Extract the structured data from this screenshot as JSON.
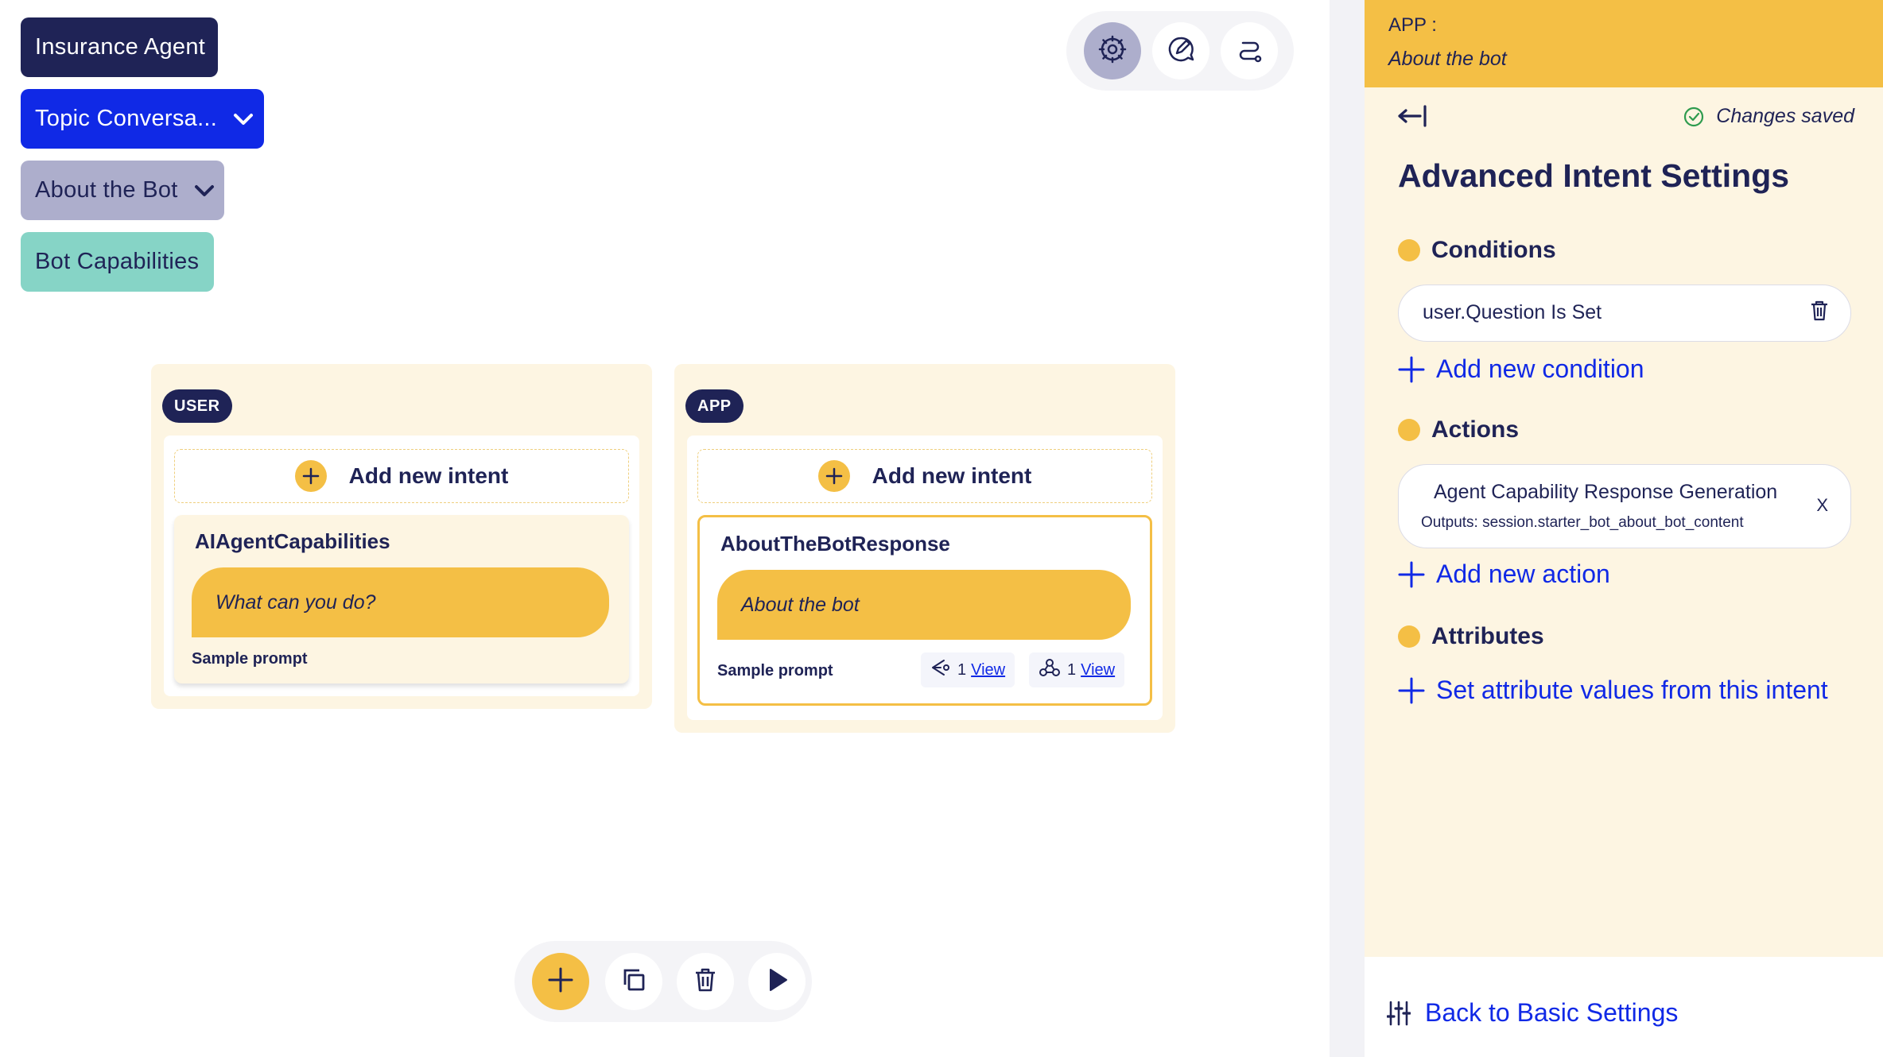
{
  "breadcrumbs": [
    {
      "label": "Insurance Agent"
    },
    {
      "label": "Topic Conversa..."
    },
    {
      "label": "About the Bot"
    },
    {
      "label": "Bot Capabilities"
    }
  ],
  "view_toolbar": {
    "icons": [
      "brain-settings-icon",
      "edit-chat-icon",
      "flow-route-icon"
    ],
    "active_index": 0
  },
  "columns": {
    "user": {
      "badge": "USER",
      "add_intent_label": "Add new intent",
      "intent": {
        "title": "AIAgentCapabilities",
        "prompt": "What can you do?",
        "sample_label": "Sample prompt"
      }
    },
    "app": {
      "badge": "APP",
      "add_intent_label": "Add new intent",
      "intent": {
        "title": "AboutTheBotResponse",
        "prompt": "About the bot",
        "sample_label": "Sample prompt",
        "views": [
          {
            "icon": "satellite-icon",
            "count": "1",
            "link": "View"
          },
          {
            "icon": "webhook-icon",
            "count": "1",
            "link": "View"
          }
        ]
      }
    }
  },
  "bottom_toolbar": {
    "icons": [
      "plus-icon",
      "copy-icon",
      "trash-icon",
      "play-icon"
    ]
  },
  "panel": {
    "header_label": "APP :",
    "header_sub": "About the bot",
    "saved_status": "Changes saved",
    "title": "Advanced Intent Settings",
    "conditions": {
      "heading": "Conditions",
      "items": [
        {
          "text": "user.Question Is Set"
        }
      ],
      "add_label": "Add new condition"
    },
    "actions": {
      "heading": "Actions",
      "items": [
        {
          "title": "Agent Capability Response Generation",
          "outputs": "Outputs: session.starter_bot_about_bot_content",
          "remove": "X"
        }
      ],
      "add_label": "Add new action"
    },
    "attributes": {
      "heading": "Attributes",
      "add_label": "Set attribute values from this intent"
    },
    "footer_link": "Back to Basic Settings"
  },
  "colors": {
    "navy": "#1f2356",
    "blue": "#1029e6",
    "yellow": "#f4bf45",
    "lavender": "#adaecc",
    "teal": "#86d4c6",
    "cream": "#fdf5e2"
  }
}
